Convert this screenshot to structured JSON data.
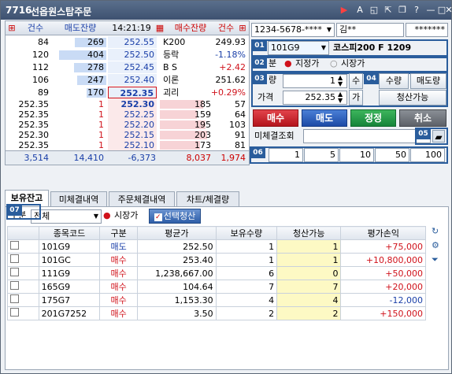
{
  "window": {
    "id": "7716",
    "title": "선옵원스탑주문"
  },
  "quotes": {
    "headers": {
      "ask_cnt": "건수",
      "ask_rem": "매도잔량",
      "time": "14:21:19",
      "bid_rem": "매수잔량",
      "bid_cnt": "건수"
    },
    "ask_rows": [
      {
        "cnt": "84",
        "rem": "269",
        "price": "252.55",
        "label": "K200",
        "value": "249.93"
      },
      {
        "cnt": "120",
        "rem": "404",
        "price": "252.50",
        "label": "등락",
        "value": "-1.18%"
      },
      {
        "cnt": "112",
        "rem": "278",
        "price": "252.45",
        "label": "B S",
        "value": "+2.42"
      },
      {
        "cnt": "106",
        "rem": "247",
        "price": "252.40",
        "label": "이론",
        "value": "251.62"
      },
      {
        "cnt": "89",
        "rem": "170",
        "price": "252.35",
        "label": "괴리",
        "value": "+0.29%"
      }
    ],
    "bid_rows": [
      {
        "left": "252.35",
        "one": "1",
        "price": "252.30",
        "rem": "185",
        "cnt": "57"
      },
      {
        "left": "252.35",
        "one": "1",
        "price": "252.25",
        "rem": "159",
        "cnt": "64"
      },
      {
        "left": "252.35",
        "one": "1",
        "price": "252.20",
        "rem": "195",
        "cnt": "103"
      },
      {
        "left": "252.30",
        "one": "1",
        "price": "252.15",
        "rem": "203",
        "cnt": "91"
      },
      {
        "left": "252.35",
        "one": "1",
        "price": "252.10",
        "rem": "173",
        "cnt": "81"
      }
    ],
    "totals": {
      "ask_cnt": "3,514",
      "ask_rem": "14,410",
      "diff": "-6,373",
      "bid_rem": "8,037",
      "bid_cnt": "1,974"
    }
  },
  "order": {
    "account": "1234-5678-****",
    "account_name": "김**",
    "password": "*******",
    "code": "101G9",
    "code_name": "코스피200 F 1209",
    "type_label": "분",
    "limit_label": "지정가",
    "market_label": "시장가",
    "qty_label": "량",
    "qty": "1",
    "qty_btn": "수",
    "max_qty_btn": "수량",
    "ask_qty_btn": "매도량",
    "price_label": "가격",
    "price": "252.35",
    "price_btn": "가",
    "liquidate_btn": "청산가능",
    "buy": "매수",
    "sell": "매도",
    "modify": "정정",
    "cancel": "취소",
    "unfilled_label": "미체결조회",
    "quick_qty": [
      "1",
      "5",
      "10",
      "50",
      "100"
    ],
    "badges": [
      "01",
      "02",
      "03",
      "04",
      "05",
      "06",
      "07"
    ]
  },
  "tabs": [
    "보유잔고",
    "미체결내역",
    "주문체결내역",
    "차트/체결량"
  ],
  "holdings": {
    "filter_label": "구분",
    "filter_value": "전체",
    "market_label": "시장가",
    "select_liq": "선택청산",
    "columns": [
      "종목코드",
      "구분",
      "평균가",
      "보유수량",
      "청산가능",
      "평가손익"
    ],
    "rows": [
      {
        "code": "101G9",
        "side": "매도",
        "avg": "252.50",
        "qty": "1",
        "liq": "1",
        "pnl": "+75,000"
      },
      {
        "code": "101GC",
        "side": "매수",
        "avg": "253.40",
        "qty": "1",
        "liq": "1",
        "pnl": "+10,800,000"
      },
      {
        "code": "111G9",
        "side": "매수",
        "avg": "1,238,667.00",
        "qty": "6",
        "liq": "0",
        "pnl": "+50,000"
      },
      {
        "code": "165G9",
        "side": "매수",
        "avg": "104.64",
        "qty": "7",
        "liq": "7",
        "pnl": "+20,000"
      },
      {
        "code": "175G7",
        "side": "매수",
        "avg": "1,153.30",
        "qty": "4",
        "liq": "4",
        "pnl": "-12,000"
      },
      {
        "code": "201G7252",
        "side": "매수",
        "avg": "3.50",
        "qty": "2",
        "liq": "2",
        "pnl": "+150,000"
      }
    ]
  },
  "colors": {
    "ask": "#1a3fa8",
    "bid": "#d0121b",
    "accent": "#2a5d9c"
  }
}
